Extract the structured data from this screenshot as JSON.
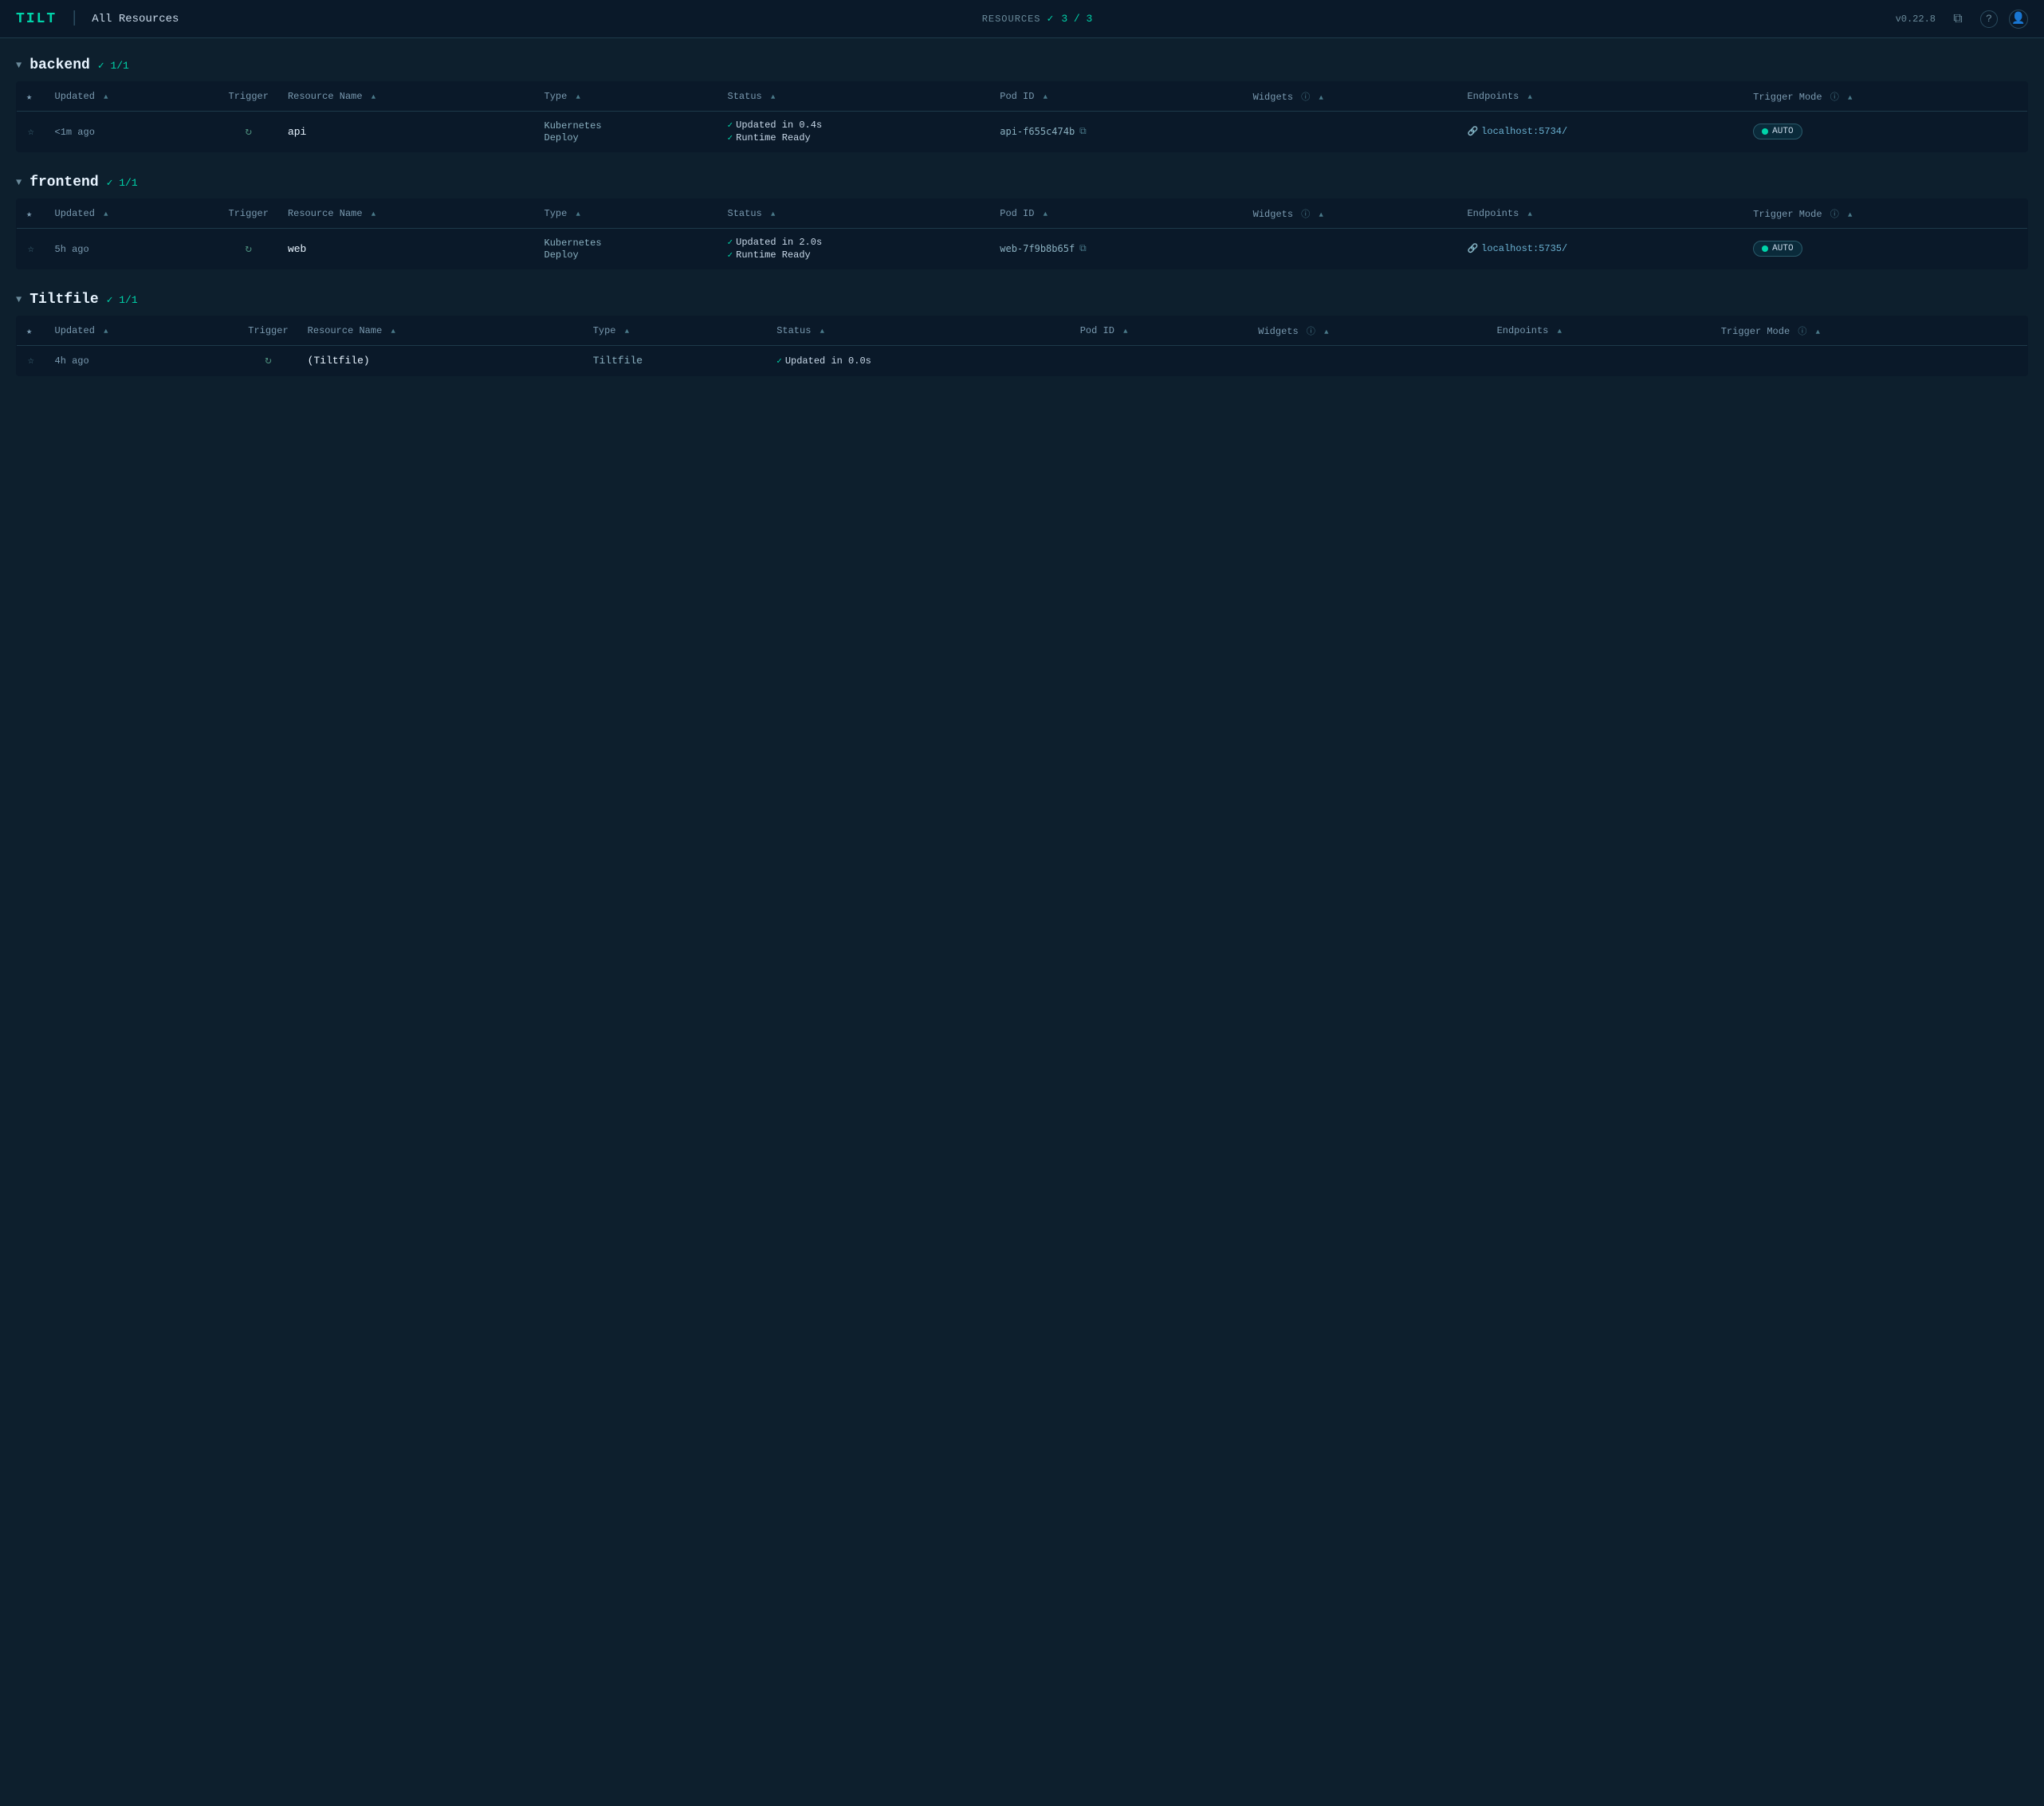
{
  "header": {
    "logo": "TILT",
    "divider": "|",
    "title": "All Resources",
    "resources_label": "RESOURCES",
    "check_icon": "✓",
    "resources_count": "3 / 3",
    "version": "v0.22.8",
    "copy_icon": "⧉",
    "help_icon": "?",
    "user_icon": "👤"
  },
  "sections": [
    {
      "id": "backend",
      "title": "backend",
      "badge": "✓ 1/1",
      "columns": [
        {
          "key": "star",
          "label": "★"
        },
        {
          "key": "updated",
          "label": "Updated",
          "sortable": true
        },
        {
          "key": "trigger",
          "label": "Trigger"
        },
        {
          "key": "resource_name",
          "label": "Resource Name",
          "sortable": true
        },
        {
          "key": "type",
          "label": "Type",
          "sortable": true
        },
        {
          "key": "status",
          "label": "Status",
          "sortable": true
        },
        {
          "key": "pod_id",
          "label": "Pod ID",
          "sortable": true
        },
        {
          "key": "widgets",
          "label": "Widgets",
          "info": true,
          "sortable": true
        },
        {
          "key": "endpoints",
          "label": "Endpoints",
          "sortable": true
        },
        {
          "key": "trigger_mode",
          "label": "Trigger Mode",
          "info": true,
          "sortable": true
        }
      ],
      "rows": [
        {
          "star": "☆",
          "updated": "<1m ago",
          "resource_name": "api",
          "type": "Kubernetes\nDeploy",
          "status_lines": [
            {
              "check": true,
              "text": "Updated in 0.4s"
            },
            {
              "check": true,
              "text": "Runtime Ready"
            }
          ],
          "pod_id": "api-f655c474b",
          "pod_id_full": "api-f655c474b",
          "endpoints": "localhost:5734/",
          "trigger_mode": "AUTO"
        }
      ]
    },
    {
      "id": "frontend",
      "title": "frontend",
      "badge": "✓ 1/1",
      "columns": [
        {
          "key": "star",
          "label": "★"
        },
        {
          "key": "updated",
          "label": "Updated",
          "sortable": true
        },
        {
          "key": "trigger",
          "label": "Trigger"
        },
        {
          "key": "resource_name",
          "label": "Resource Name",
          "sortable": true
        },
        {
          "key": "type",
          "label": "Type",
          "sortable": true
        },
        {
          "key": "status",
          "label": "Status",
          "sortable": true
        },
        {
          "key": "pod_id",
          "label": "Pod ID",
          "sortable": true
        },
        {
          "key": "widgets",
          "label": "Widgets",
          "info": true,
          "sortable": true
        },
        {
          "key": "endpoints",
          "label": "Endpoints",
          "sortable": true
        },
        {
          "key": "trigger_mode",
          "label": "Trigger Mode",
          "info": true,
          "sortable": true
        }
      ],
      "rows": [
        {
          "star": "☆",
          "updated": "5h ago",
          "resource_name": "web",
          "type": "Kubernetes\nDeploy",
          "status_lines": [
            {
              "check": true,
              "text": "Updated in 2.0s"
            },
            {
              "check": true,
              "text": "Runtime Ready"
            }
          ],
          "pod_id": "web-7f9b8b65f",
          "endpoints": "localhost:5735/",
          "trigger_mode": "AUTO"
        }
      ]
    },
    {
      "id": "tiltfile",
      "title": "Tiltfile",
      "badge": "✓ 1/1",
      "columns": [
        {
          "key": "star",
          "label": "★"
        },
        {
          "key": "updated",
          "label": "Updated",
          "sortable": true
        },
        {
          "key": "trigger",
          "label": "Trigger"
        },
        {
          "key": "resource_name",
          "label": "Resource Name",
          "sortable": true
        },
        {
          "key": "type",
          "label": "Type",
          "sortable": true
        },
        {
          "key": "status",
          "label": "Status",
          "sortable": true
        },
        {
          "key": "pod_id",
          "label": "Pod ID",
          "sortable": true
        },
        {
          "key": "widgets",
          "label": "Widgets",
          "info": true,
          "sortable": true
        },
        {
          "key": "endpoints",
          "label": "Endpoints",
          "sortable": true
        },
        {
          "key": "trigger_mode",
          "label": "Trigger Mode",
          "info": true,
          "sortable": true
        }
      ],
      "rows": [
        {
          "star": "☆",
          "updated": "4h ago",
          "resource_name": "(Tiltfile)",
          "type": "Tiltfile",
          "status_lines": [
            {
              "check": true,
              "text": "Updated in 0.0s"
            }
          ],
          "pod_id": "",
          "endpoints": "",
          "trigger_mode": ""
        }
      ]
    }
  ],
  "sort_asc": "▲",
  "copy_symbol": "⧉",
  "link_symbol": "🔗"
}
